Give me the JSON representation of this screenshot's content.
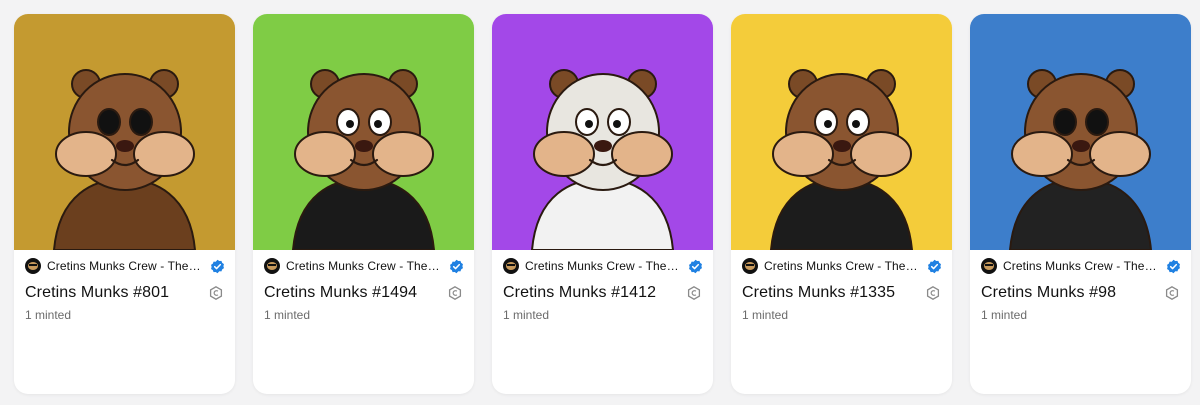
{
  "cards": [
    {
      "collection": "Cretins Munks Crew - The ...",
      "title": "Cretins Munks #801",
      "minted": "1 minted",
      "bg": "#c49a30",
      "icons": {
        "avatar": "collection-avatar-icon",
        "verified": "verified-badge-icon",
        "chain": "chain-icon"
      }
    },
    {
      "collection": "Cretins Munks Crew - The ...",
      "title": "Cretins Munks #1494",
      "minted": "1 minted",
      "bg": "#7fcc45",
      "icons": {
        "avatar": "collection-avatar-icon",
        "verified": "verified-badge-icon",
        "chain": "chain-icon"
      }
    },
    {
      "collection": "Cretins Munks Crew - The ...",
      "title": "Cretins Munks #1412",
      "minted": "1 minted",
      "bg": "#a348e8",
      "icons": {
        "avatar": "collection-avatar-icon",
        "verified": "verified-badge-icon",
        "chain": "chain-icon"
      }
    },
    {
      "collection": "Cretins Munks Crew - The ...",
      "title": "Cretins Munks #1335",
      "minted": "1 minted",
      "bg": "#f4cc3a",
      "icons": {
        "avatar": "collection-avatar-icon",
        "verified": "verified-badge-icon",
        "chain": "chain-icon"
      }
    },
    {
      "collection": "Cretins Munks Crew - The ...",
      "title": "Cretins Munks #98",
      "minted": "1 minted",
      "bg": "#3d7ecb",
      "icons": {
        "avatar": "collection-avatar-icon",
        "verified": "verified-badge-icon",
        "chain": "chain-icon"
      }
    }
  ],
  "colors": {
    "verified": "#2081e2",
    "chain": "#8a8a8a"
  }
}
